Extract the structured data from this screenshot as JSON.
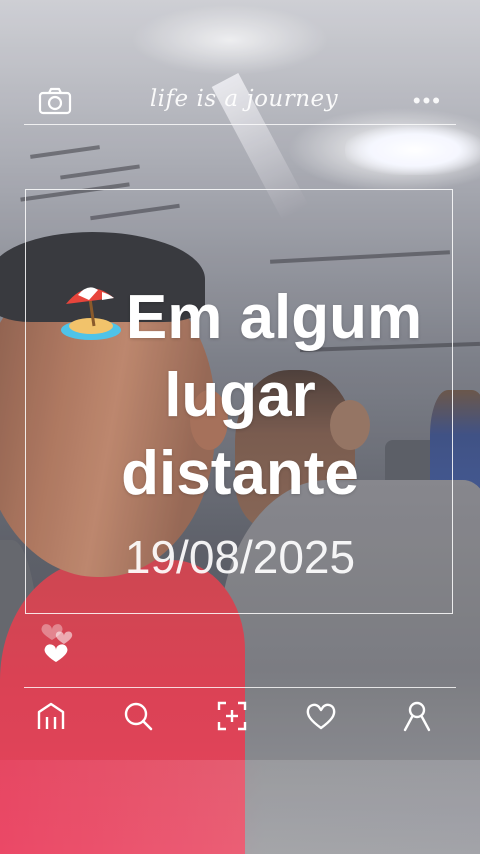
{
  "app": {
    "header": {
      "script_title": "life is a journey"
    },
    "caption": {
      "emoji": "beach-umbrella-island-emoji",
      "line1": "Em algum",
      "line2": "lugar",
      "line3": "distante"
    },
    "date": "19/08/2025",
    "icons": {
      "camera": "camera-icon",
      "more": "more-dots-icon",
      "hearts": "hearts-icon",
      "nav": [
        "home-icon",
        "search-icon",
        "add-capture-icon",
        "heart-icon",
        "profile-icon"
      ]
    },
    "colors": {
      "overlay_white": "#ffffff",
      "shirt_red": "#d62d41"
    }
  }
}
